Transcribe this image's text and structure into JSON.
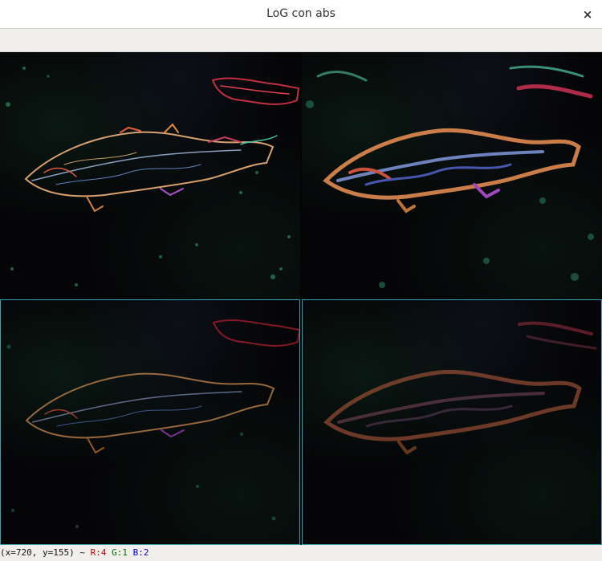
{
  "window": {
    "title": "LoG con abs",
    "close_glyph": "×"
  },
  "status": {
    "coords": "(x=720, y=155) ~",
    "r": "R:4",
    "g": "G:1",
    "b": "B:2"
  },
  "colors": {
    "border_highlight": "#3aa0b8",
    "r_text": "#c00000",
    "g_text": "#007000",
    "b_text": "#0000c0"
  },
  "icons": {
    "close": "close-icon"
  }
}
